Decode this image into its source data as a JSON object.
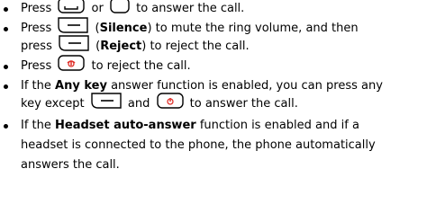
{
  "items": [
    {
      "line1": {
        "t1": "Press",
        "t2": "or",
        "t3": "to answer the call."
      },
      "icons": [
        "answer-key-icon",
        "blank-key-icon"
      ]
    },
    {
      "line1": {
        "t1": "Press",
        "t2": "(",
        "bold": "Silence",
        "t3": ") to mute the ring volume, and then"
      },
      "line2": {
        "t1": "press",
        "t2": "(",
        "bold": "Reject",
        "t3": ") to reject the call."
      },
      "icons": [
        "softkey-icon",
        "softkey-icon"
      ]
    },
    {
      "line1": {
        "t1": "Press",
        "t3": "to reject the call."
      },
      "icons": [
        "end-call-key-icon"
      ]
    },
    {
      "line1": {
        "t1": "If the",
        "bold": "Any key",
        "t2": "answer function is enabled, you can press any"
      },
      "line2": {
        "t1": "key except",
        "t2": "and",
        "t3": "to answer the call."
      },
      "icons": [
        "softkey-icon",
        "end-call-key-icon"
      ]
    },
    {
      "line1": {
        "t1": "If the",
        "bold": "Headset auto-answer",
        "t2": "function is enabled and if a"
      },
      "line2": "headset is connected to the phone, the phone automatically",
      "line3": "answers the call."
    }
  ],
  "colors": {
    "key_outline": "#000000",
    "end_call_accent": "#e0302a"
  }
}
